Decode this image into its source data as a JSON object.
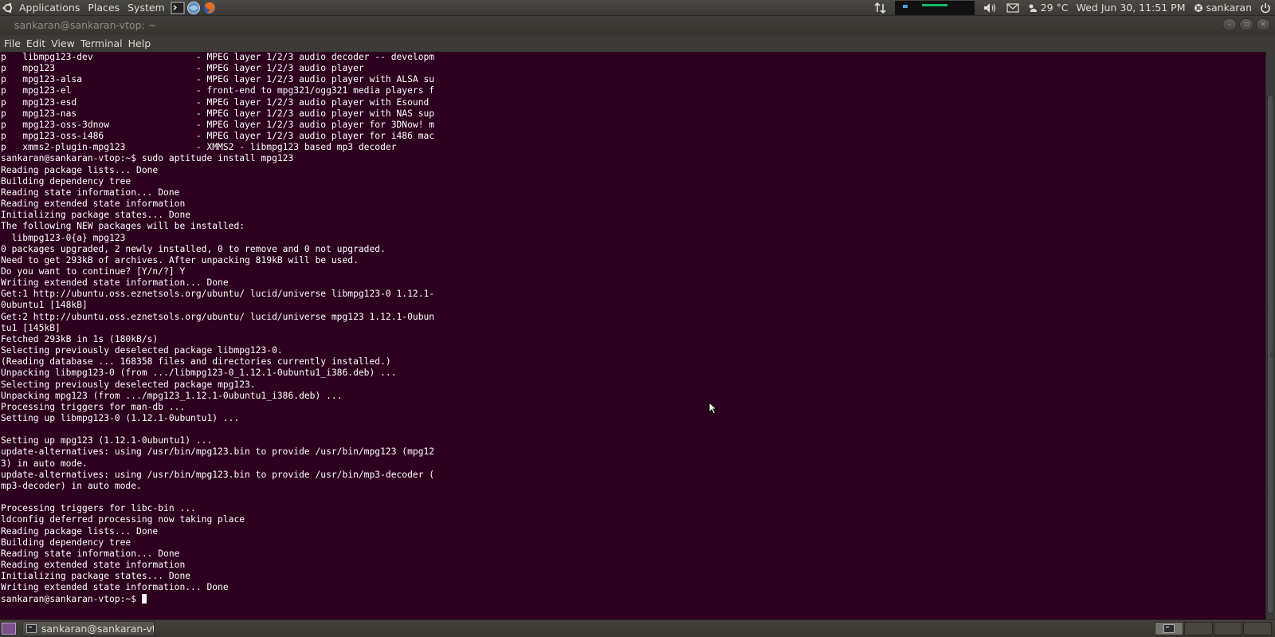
{
  "top_panel": {
    "menus": [
      "Applications",
      "Places",
      "System"
    ],
    "temperature": "29 °C",
    "clock": "Wed Jun 30, 11:51 PM",
    "user": "sankaran",
    "icons": [
      "ubuntu-logo-icon",
      "terminal-launcher-icon",
      "network-launcher-icon",
      "firefox-launcher-icon",
      "network-transfer-icon",
      "volume-icon",
      "mail-icon",
      "weather-icon",
      "user-status-icon",
      "power-icon"
    ]
  },
  "window": {
    "title": "sankaran@sankaran-vtop: ~"
  },
  "menubar": {
    "file": "File",
    "edit": "Edit",
    "view": "View",
    "terminal": "Terminal",
    "help": "Help"
  },
  "terminal": {
    "output": "p   libmpg123-dev                   - MPEG layer 1/2/3 audio decoder -- developm\np   mpg123                          - MPEG layer 1/2/3 audio player\np   mpg123-alsa                     - MPEG layer 1/2/3 audio player with ALSA su\np   mpg123-el                       - front-end to mpg321/ogg321 media players f\np   mpg123-esd                      - MPEG layer 1/2/3 audio player with Esound\np   mpg123-nas                      - MPEG layer 1/2/3 audio player with NAS sup\np   mpg123-oss-3dnow                - MPEG layer 1/2/3 audio player for 3DNow! m\np   mpg123-oss-i486                 - MPEG layer 1/2/3 audio player for i486 mac\np   xmms2-plugin-mpg123             - XMMS2 - libmpg123 based mp3 decoder\nsankaran@sankaran-vtop:~$ sudo aptitude install mpg123\nReading package lists... Done\nBuilding dependency tree\nReading state information... Done\nReading extended state information\nInitializing package states... Done\nThe following NEW packages will be installed:\n  libmpg123-0{a} mpg123\n0 packages upgraded, 2 newly installed, 0 to remove and 0 not upgraded.\nNeed to get 293kB of archives. After unpacking 819kB will be used.\nDo you want to continue? [Y/n/?] Y\nWriting extended state information... Done\nGet:1 http://ubuntu.oss.eznetsols.org/ubuntu/ lucid/universe libmpg123-0 1.12.1-\n0ubuntu1 [148kB]\nGet:2 http://ubuntu.oss.eznetsols.org/ubuntu/ lucid/universe mpg123 1.12.1-0ubun\ntu1 [145kB]\nFetched 293kB in 1s (180kB/s)\nSelecting previously deselected package libmpg123-0.\n(Reading database ... 168358 files and directories currently installed.)\nUnpacking libmpg123-0 (from .../libmpg123-0_1.12.1-0ubuntu1_i386.deb) ...\nSelecting previously deselected package mpg123.\nUnpacking mpg123 (from .../mpg123_1.12.1-0ubuntu1_i386.deb) ...\nProcessing triggers for man-db ...\nSetting up libmpg123-0 (1.12.1-0ubuntu1) ...\n\nSetting up mpg123 (1.12.1-0ubuntu1) ...\nupdate-alternatives: using /usr/bin/mpg123.bin to provide /usr/bin/mpg123 (mpg12\n3) in auto mode.\nupdate-alternatives: using /usr/bin/mpg123.bin to provide /usr/bin/mp3-decoder (\nmp3-decoder) in auto mode.\n\nProcessing triggers for libc-bin ...\nldconfig deferred processing now taking place\nReading package lists... Done\nBuilding dependency tree\nReading state information... Done\nReading extended state information\nInitializing package states... Done\nWriting extended state information... Done\n",
    "prompt": "sankaran@sankaran-vtop:~$ "
  },
  "bottom_panel": {
    "taskbar_item": "sankaran@sankaran-vt..."
  },
  "colors": {
    "terminal_bg": "#2c001e",
    "terminal_fg": "#ffffff",
    "panel_bg": "#3c3b37"
  }
}
